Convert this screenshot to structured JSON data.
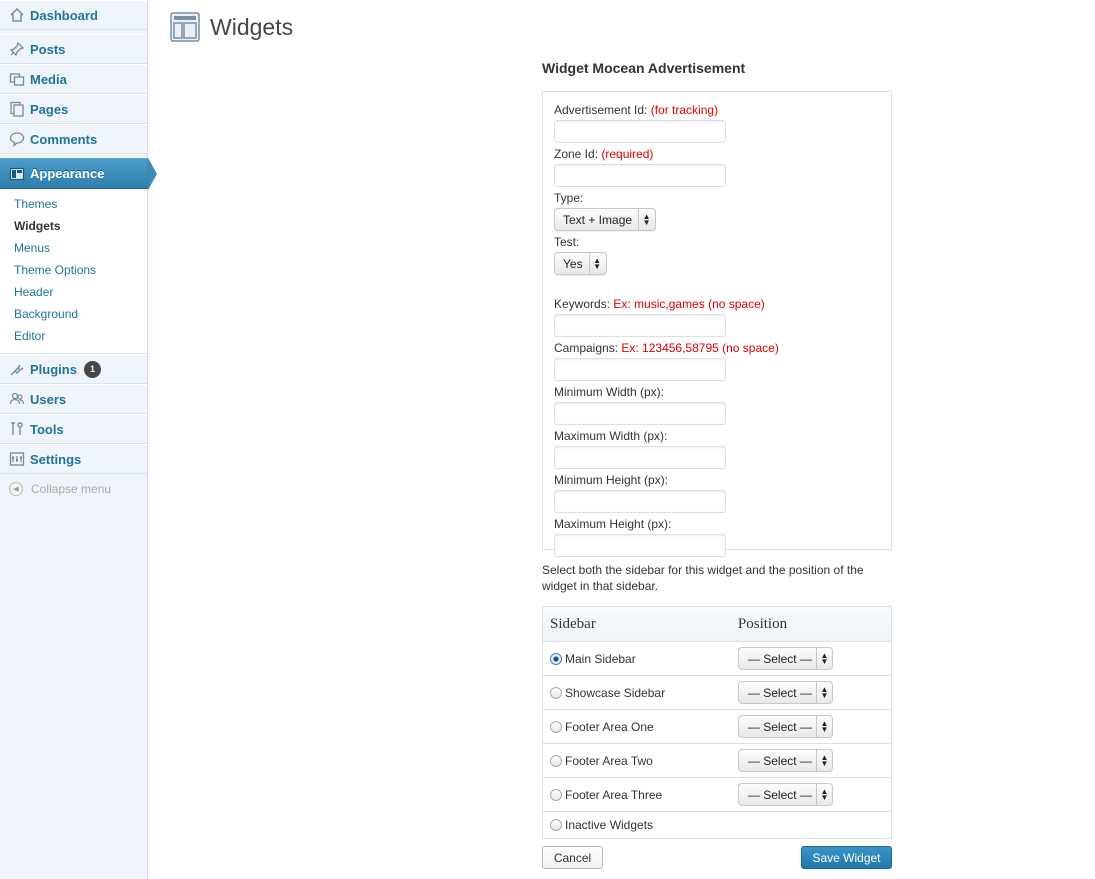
{
  "nav": {
    "dashboard": "Dashboard",
    "posts": "Posts",
    "media": "Media",
    "pages": "Pages",
    "comments": "Comments",
    "appearance": "Appearance",
    "appearance_sub": [
      "Themes",
      "Widgets",
      "Menus",
      "Theme Options",
      "Header",
      "Background",
      "Editor"
    ],
    "plugins": "Plugins",
    "plugins_badge": "1",
    "users": "Users",
    "tools": "Tools",
    "settings": "Settings",
    "collapse": "Collapse menu"
  },
  "header": {
    "title": "Widgets"
  },
  "widget": {
    "title": "Widget Mocean Advertisement",
    "fields": {
      "ad_id_label": "Advertisement Id:",
      "ad_id_hint": "(for tracking)",
      "zone_id_label": "Zone Id:",
      "zone_id_hint": "(required)",
      "type_label": "Type:",
      "type_value": "Text + Image",
      "test_label": "Test:",
      "test_value": "Yes",
      "keywords_label": "Keywords:",
      "keywords_hint": "Ex: music,games (no space)",
      "campaigns_label": "Campaigns:",
      "campaigns_hint": "Ex: 123456,58795 (no space)",
      "min_width_label": "Minimum Width (px):",
      "max_width_label": "Maximum Width (px):",
      "min_height_label": "Minimum Height (px):",
      "max_height_label": "Maximum Height (px):"
    },
    "select_desc": "Select both the sidebar for this widget and the position of the widget in that sidebar.",
    "table": {
      "col_sidebar": "Sidebar",
      "col_position": "Position",
      "rows": [
        {
          "name": "Main Sidebar",
          "position": "— Select —",
          "checked": true
        },
        {
          "name": "Showcase Sidebar",
          "position": "— Select —",
          "checked": false
        },
        {
          "name": "Footer Area One",
          "position": "— Select —",
          "checked": false
        },
        {
          "name": "Footer Area Two",
          "position": "— Select —",
          "checked": false
        },
        {
          "name": "Footer Area Three",
          "position": "— Select —",
          "checked": false
        },
        {
          "name": "Inactive Widgets",
          "position": "",
          "checked": false
        }
      ]
    },
    "cancel_label": "Cancel",
    "save_label": "Save Widget"
  },
  "colors": {
    "link": "#21759b",
    "active_nav": "#3a8dbd",
    "hint": "#dd0000",
    "primary_button": "#2179ab"
  }
}
